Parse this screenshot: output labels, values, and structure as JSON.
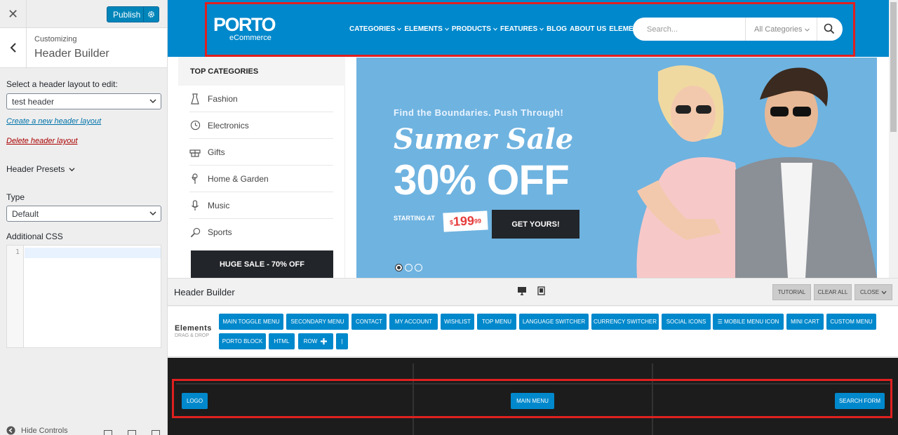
{
  "panel": {
    "publish_label": "Publish",
    "customizing_label": "Customizing",
    "section_title": "Header Builder",
    "select_layout_label": "Select a header layout to edit:",
    "layout_value": "test header",
    "create_link": "Create a new header layout",
    "delete_link": "Delete header layout",
    "presets_label": "Header Presets",
    "type_label": "Type",
    "type_value": "Default",
    "css_label": "Additional CSS",
    "line_number": "1",
    "hide_controls": "Hide Controls"
  },
  "site": {
    "logo_main": "PORTO",
    "logo_sub": "eCommerce",
    "nav": [
      "CATEGORIES",
      "ELEMENTS",
      "PRODUCTS",
      "FEATURES",
      "BLOG",
      "ABOUT US",
      "ELEMENTS"
    ],
    "search_placeholder": "Search...",
    "search_category": "All Categories"
  },
  "categories": {
    "heading": "TOP CATEGORIES",
    "items": [
      "Fashion",
      "Electronics",
      "Gifts",
      "Home & Garden",
      "Music",
      "Sports"
    ],
    "huge_sale": "HUGE SALE - 70% OFF"
  },
  "banner": {
    "tagline": "Find the Boundaries. Push Through!",
    "script": "Sumer Sale",
    "big": "30% OFF",
    "starting": "STARTING AT",
    "price_currency": "$",
    "price_main": "199",
    "price_cents": "99",
    "cta": "GET YOURS!"
  },
  "builder": {
    "title": "Header Builder",
    "tutorial": "TUTORIAL",
    "clear_all": "CLEAR ALL",
    "close": "CLOSE",
    "elements_title": "Elements",
    "elements_sub": "DRAG & DROP",
    "chips_row1": [
      "MAIN TOGGLE MENU",
      "SECONDARY MENU",
      "CONTACT",
      "MY ACCOUNT",
      "WISHLIST",
      "TOP MENU",
      "LANGUAGE SWITCHER",
      "CURRENCY SWITCHER",
      "SOCIAL ICONS",
      "☰ MOBILE MENU ICON",
      "MINI CART",
      "CUSTOM MENU"
    ],
    "chips_row2": [
      "PORTO BLOCK",
      "HTML",
      "ROW",
      "|"
    ],
    "slot_logo": "LOGO",
    "slot_menu": "MAIN MENU",
    "slot_search": "SEARCH FORM"
  },
  "colors": {
    "wp_blue": "#0085ba",
    "porto_blue": "#0088cc",
    "highlight": "#e02020",
    "dark": "#222529"
  }
}
